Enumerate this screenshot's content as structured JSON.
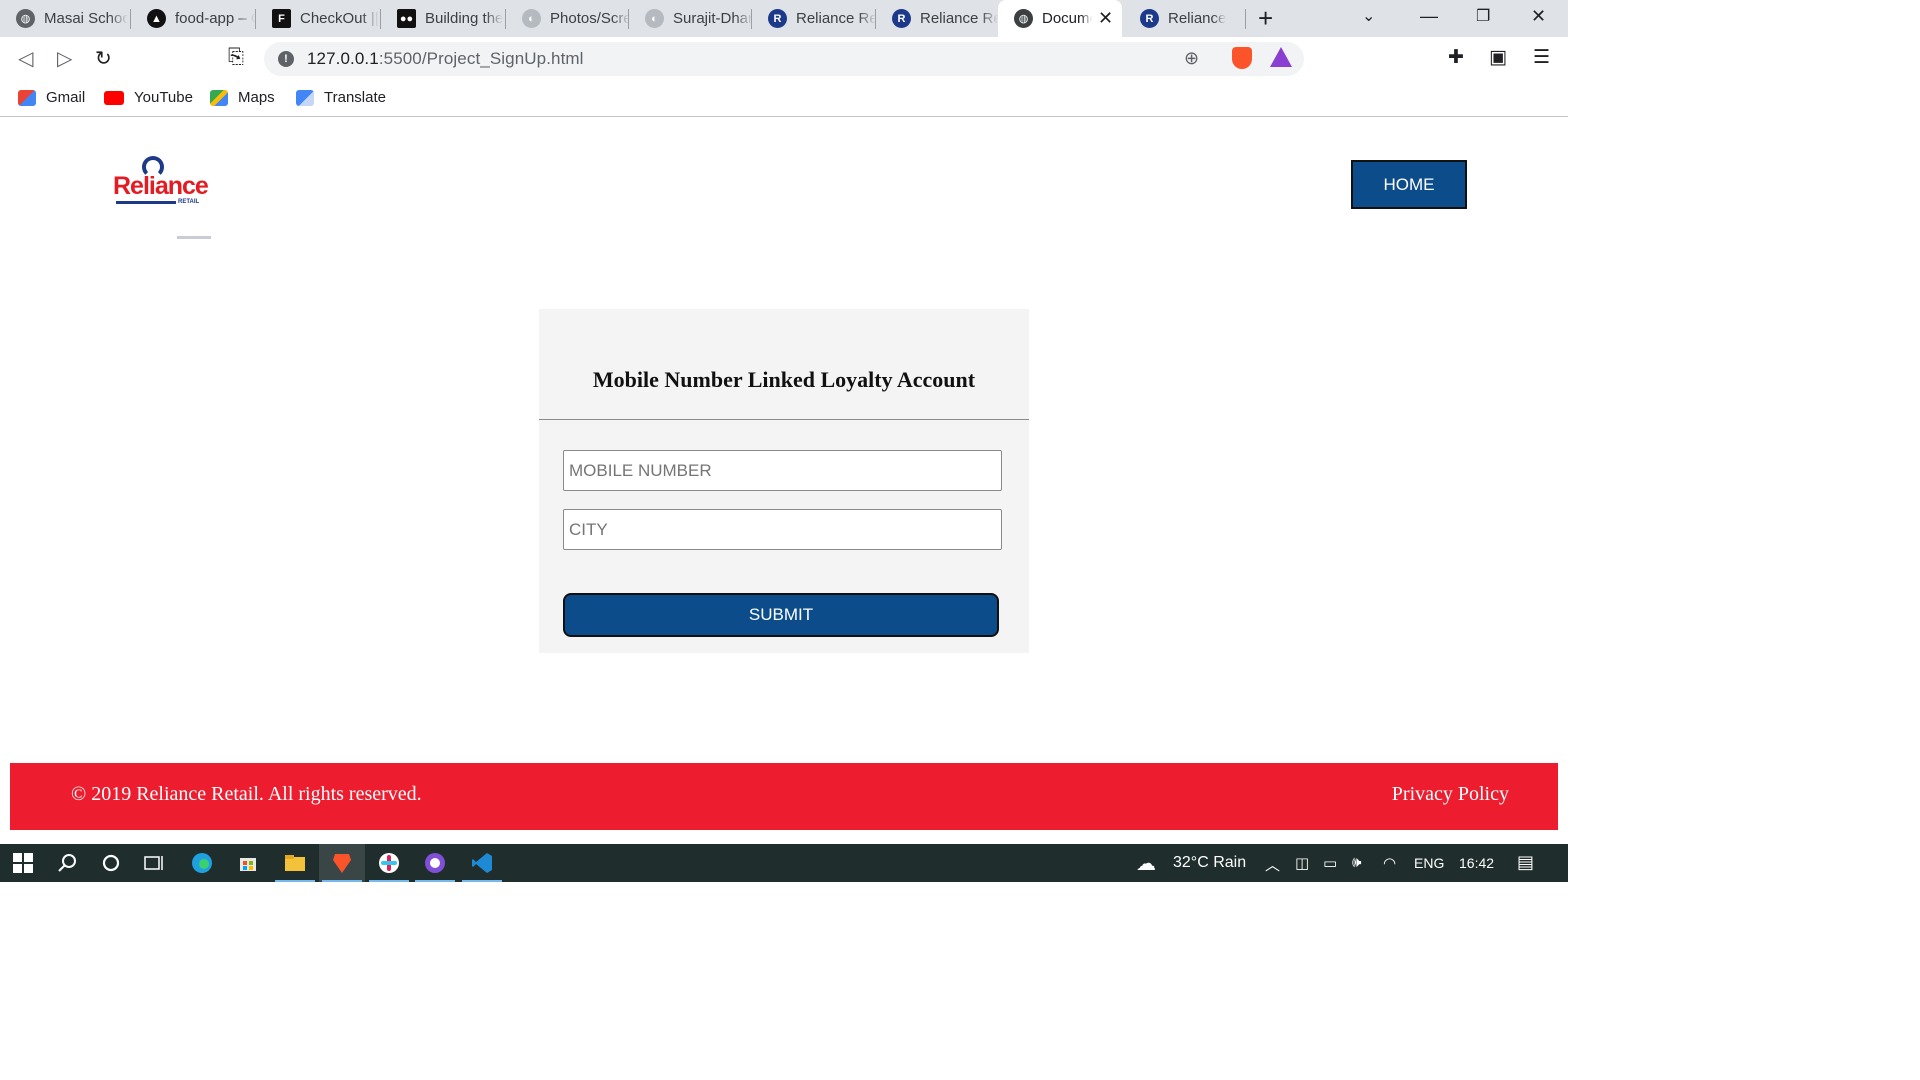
{
  "browser": {
    "tabs": [
      {
        "title": "Masai School",
        "icon_color": "#5f6368",
        "icon_glyph": "◍",
        "active": false
      },
      {
        "title": "food-app – C",
        "icon_color": "#111111",
        "icon_glyph": "▲",
        "active": false
      },
      {
        "title": "CheckOut ||",
        "icon_color": "#111111",
        "icon_glyph": "F",
        "active": false
      },
      {
        "title": "Building the",
        "icon_color": "#111111",
        "icon_glyph": "●",
        "active": false
      },
      {
        "title": "Photos/Scre",
        "icon_color": "#8a9097",
        "icon_glyph": "◐",
        "active": false
      },
      {
        "title": "Surajit-Dhar",
        "icon_color": "#8a9097",
        "icon_glyph": "◐",
        "active": false
      },
      {
        "title": "Reliance Ret",
        "icon_color": "#1d3a8a",
        "icon_glyph": "R",
        "active": false
      },
      {
        "title": "Reliance Ret",
        "icon_color": "#1d3a8a",
        "icon_glyph": "R",
        "active": false
      },
      {
        "title": "Document",
        "icon_color": "#3c4043",
        "icon_glyph": "◍",
        "active": true
      },
      {
        "title": "Reliance",
        "icon_color": "#1d3a8a",
        "icon_glyph": "R",
        "active": false
      }
    ],
    "address": {
      "host": "127.0.0.1",
      "path": ":5500/Project_SignUp.html"
    },
    "bookmarks": [
      {
        "label": "Gmail",
        "icon_color": "#ea4335"
      },
      {
        "label": "YouTube",
        "icon_color": "#ff0000"
      },
      {
        "label": "Maps",
        "icon_color": "#34a853"
      },
      {
        "label": "Translate",
        "icon_color": "#4285f4"
      }
    ]
  },
  "page": {
    "logo": {
      "text": "Reliance",
      "subtext": "RETAIL"
    },
    "home_label": "HOME",
    "form": {
      "title": "Mobile Number Linked Loyalty Account",
      "mobile_placeholder": "MOBILE NUMBER",
      "city_placeholder": "CITY",
      "submit_label": "SUBMIT"
    },
    "footer": {
      "copyright": "© 2019 Reliance Retail. All rights reserved.",
      "privacy": "Privacy Policy"
    }
  },
  "taskbar": {
    "weather": "32°C  Rain",
    "language": "ENG",
    "time": "16:42"
  }
}
